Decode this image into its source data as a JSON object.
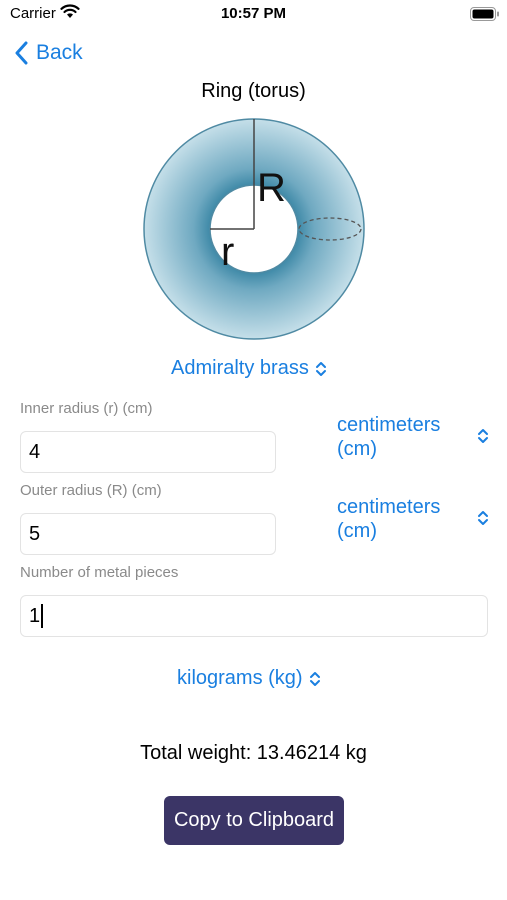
{
  "status_bar": {
    "carrier": "Carrier",
    "time": "10:57 PM"
  },
  "nav": {
    "back_label": "Back"
  },
  "shape_title": "Ring (torus)",
  "diagram": {
    "outer_label": "R",
    "inner_label": "r"
  },
  "material_picker": {
    "selected": "Admiralty brass"
  },
  "inner_radius": {
    "label": "Inner radius (r) (cm)",
    "value": "4",
    "unit_line1": "centimeters",
    "unit_line2": "(cm)"
  },
  "outer_radius": {
    "label": "Outer radius (R) (cm)",
    "value": "5",
    "unit_line1": "centimeters",
    "unit_line2": "(cm)"
  },
  "pieces": {
    "label": "Number of metal pieces",
    "value": "1"
  },
  "weight_unit_picker": {
    "selected": "kilograms (kg)"
  },
  "result": {
    "total": "Total weight: 13.46214 kg"
  },
  "copy_button": {
    "label": "Copy to Clipboard"
  },
  "colors": {
    "accent": "#1a7fe0",
    "button": "#3b3566",
    "ring": "#7fb3c8"
  }
}
